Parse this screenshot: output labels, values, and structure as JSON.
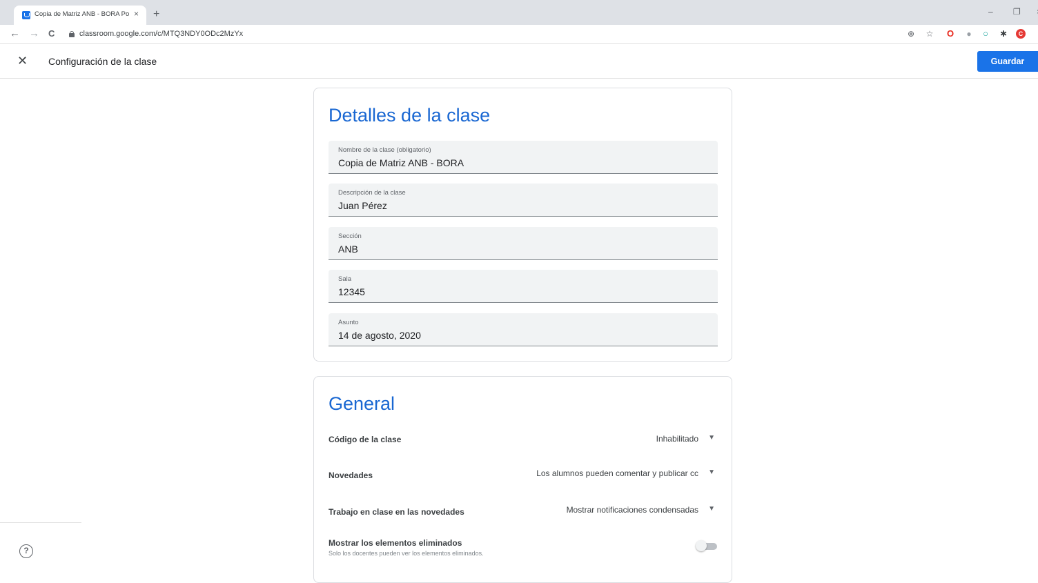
{
  "browser": {
    "tab_title": "Copia de Matriz ANB - BORA Po",
    "tab_close": "×",
    "new_tab": "+",
    "minimize": "–",
    "maximize": "❐",
    "close": "×",
    "url": "classroom.google.com/c/MTQ3NDY0ODc2MzYx",
    "back": "←",
    "forward": "→",
    "reload": "C",
    "extensions": [
      {
        "name": "zoom-icon",
        "glyph": "⊕",
        "color": "#5f6368"
      },
      {
        "name": "star-icon",
        "glyph": "☆",
        "color": "#5f6368"
      },
      {
        "name": "opera-icon",
        "glyph": "O",
        "color": "#e8271b"
      },
      {
        "name": "ext-gray-icon",
        "glyph": "●",
        "color": "#9aa0a6"
      },
      {
        "name": "ext-teal-icon",
        "glyph": "○",
        "color": "#1aa39c"
      },
      {
        "name": "puzzle-icon",
        "glyph": "✱",
        "color": "#3c4043"
      },
      {
        "name": "profile-avatar",
        "glyph": "C",
        "color": "#e53935"
      }
    ]
  },
  "header": {
    "close_glyph": "✕",
    "title": "Configuración de la clase",
    "save_label": "Guardar"
  },
  "details": {
    "title": "Detalles de la clase",
    "fields": [
      {
        "label": "Nombre de la clase (obligatorio)",
        "value": "Copia de Matriz ANB - BORA"
      },
      {
        "label": "Descripción de la clase",
        "value": "Juan Pérez"
      },
      {
        "label": "Sección",
        "value": "ANB"
      },
      {
        "label": "Sala",
        "value": "12345"
      },
      {
        "label": "Asunto",
        "value": "14 de agosto, 2020"
      }
    ]
  },
  "general": {
    "title": "General",
    "rows": [
      {
        "label": "Código de la clase",
        "value": "Inhabilitado"
      },
      {
        "label": "Novedades",
        "value": "Los alumnos pueden comentar y publicar cc"
      },
      {
        "label": "Trabajo en clase en las novedades",
        "value": "Mostrar notificaciones condensadas"
      }
    ],
    "deleted": {
      "label": "Mostrar los elementos eliminados",
      "sub": "Solo los docentes pueden ver los elementos eliminados.",
      "enabled": false
    },
    "caret": "▼"
  },
  "help_glyph": "?"
}
